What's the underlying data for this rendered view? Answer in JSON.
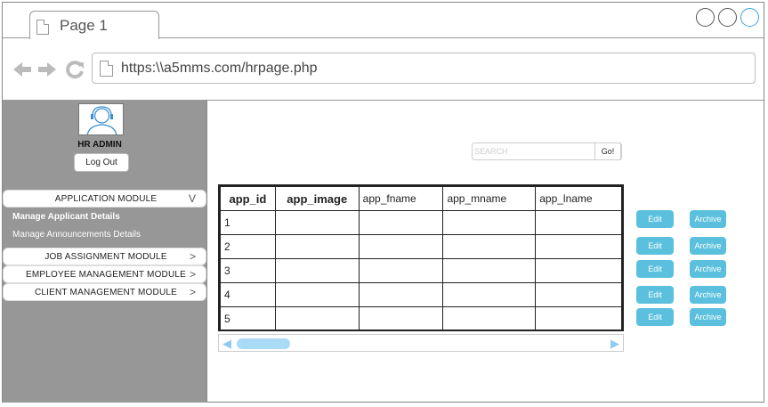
{
  "browser": {
    "tab_title": "Page 1",
    "url": "https:\\\\a5mms.com/hrpage.php"
  },
  "sidebar": {
    "role": "HR ADMIN",
    "logout_label": "Log Out",
    "modules": [
      {
        "label": "APPLICATION MODULE",
        "chevron": "V"
      },
      {
        "label": "JOB ASSIGNMENT MODULE",
        "chevron": ">"
      },
      {
        "label": "EMPLOYEE MANAGEMENT MODULE",
        "chevron": ">"
      },
      {
        "label": "CLIENT MANAGEMENT MODULE",
        "chevron": ">"
      }
    ],
    "subitems": [
      {
        "label": "Manage Applicant Details"
      },
      {
        "label": "Manage Announcements Details"
      }
    ]
  },
  "search": {
    "placeholder": "SEARCH",
    "go_label": "Go!"
  },
  "table": {
    "headers": [
      "app_id",
      "app_image",
      "app_fname",
      "app_mname",
      "app_lname"
    ],
    "rows": [
      [
        "1",
        "",
        "",
        "",
        ""
      ],
      [
        "2",
        "",
        "",
        "",
        ""
      ],
      [
        "3",
        "",
        "",
        "",
        ""
      ],
      [
        "4",
        "",
        "",
        "",
        ""
      ],
      [
        "5",
        "",
        "",
        "",
        ""
      ]
    ]
  },
  "actions": {
    "edit_label": "Edit",
    "archive_label": "Archive"
  },
  "colors": {
    "sidebar_bg": "#979797",
    "action_button": "#5bc0de",
    "scroll_accent": "#a9daf6"
  }
}
